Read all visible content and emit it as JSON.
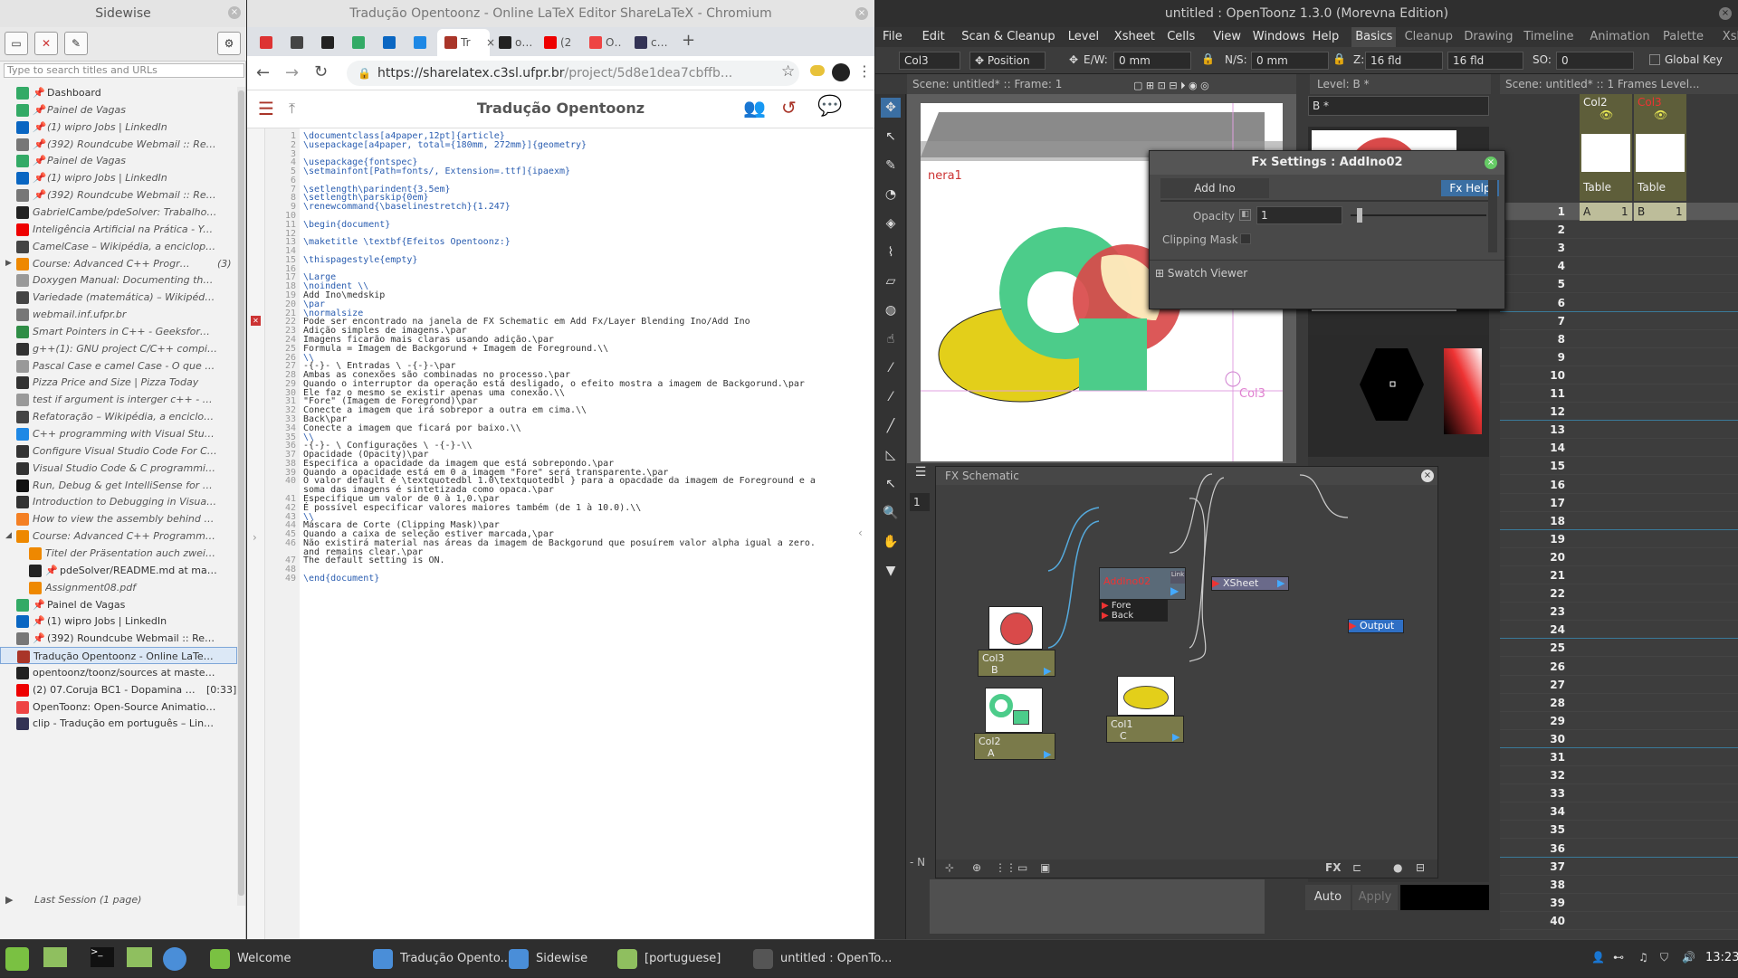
{
  "sidewise": {
    "title": "Sidewise",
    "search_placeholder": "Type to search titles and URLs",
    "items": [
      {
        "label": "Dashboard",
        "pinned": true,
        "icon": "trello-icon",
        "color": "#3a6"
      },
      {
        "label": "Painel de Vagas",
        "pinned": true,
        "icon": "trello-icon",
        "color": "#3a6",
        "italic": true
      },
      {
        "label": "(1) wipro Jobs | LinkedIn",
        "pinned": true,
        "icon": "linkedin-icon",
        "color": "#0a66c2",
        "italic": true
      },
      {
        "label": "(392) Roundcube Webmail :: Resulta...",
        "pinned": true,
        "icon": "roundcube-icon",
        "color": "#777",
        "italic": true
      },
      {
        "label": "Painel de Vagas",
        "pinned": true,
        "icon": "trello-icon",
        "color": "#3a6",
        "italic": true
      },
      {
        "label": "(1) wipro Jobs | LinkedIn",
        "pinned": true,
        "icon": "linkedin-icon",
        "color": "#0a66c2",
        "italic": true
      },
      {
        "label": "(392) Roundcube Webmail :: Resulta...",
        "pinned": true,
        "icon": "roundcube-icon",
        "color": "#777",
        "italic": true
      },
      {
        "label": "GabrielCambe/pdeSolver: Trabalho 1 da d...",
        "icon": "github-icon",
        "color": "#222",
        "italic": true
      },
      {
        "label": "Inteligência Artificial na Prática - YouTube",
        "icon": "youtube-icon",
        "color": "#e00",
        "italic": true
      },
      {
        "label": "CamelCase – Wikipédia, a enciclopédia livre",
        "icon": "wikipedia-icon",
        "color": "#444",
        "italic": true
      },
      {
        "label": "Course: Advanced C++ Programming",
        "icon": "moodle-icon",
        "color": "#e80",
        "italic": true,
        "count": "(3)",
        "expander": "▶"
      },
      {
        "label": "Doxygen Manual: Documenting the code",
        "icon": "doxygen-icon",
        "color": "#999",
        "italic": true
      },
      {
        "label": "Variedade (matemática) – Wikipédia, a en...",
        "icon": "wikipedia-icon",
        "color": "#444",
        "italic": true
      },
      {
        "label": "webmail.inf.ufpr.br",
        "icon": "roundcube-icon",
        "color": "#777",
        "italic": true
      },
      {
        "label": "Smart Pointers in C++ - GeeksforGeeks",
        "icon": "gfg-icon",
        "color": "#2f8d46",
        "italic": true
      },
      {
        "label": "g++(1): GNU project C/C++ compiler - Lin...",
        "icon": "terminal-icon",
        "color": "#333",
        "italic": true
      },
      {
        "label": "Pascal Case e camel Case - O que é e co...",
        "icon": "page-icon",
        "color": "#999",
        "italic": true
      },
      {
        "label": "Pizza Price and Size | Pizza Today",
        "icon": "pizza-icon",
        "color": "#333",
        "italic": true
      },
      {
        "label": "test if argument is interger c++ - Pesquisa ...",
        "icon": "google-icon",
        "color": "#999",
        "italic": true
      },
      {
        "label": "Refatoração – Wikipédia, a enciclopédia li...",
        "icon": "wikipedia-icon",
        "color": "#444",
        "italic": true
      },
      {
        "label": "C++ programming with Visual Studio Code",
        "icon": "vscode-icon",
        "color": "#1e88e5",
        "italic": true
      },
      {
        "label": "Configure Visual Studio Code For C++ De...",
        "icon": "vscode-icon",
        "color": "#333",
        "italic": true
      },
      {
        "label": "Visual Studio Code & C programming on ...",
        "icon": "vscode-icon",
        "color": "#333",
        "italic": true
      },
      {
        "label": "Run, Debug & get IntelliSense for C C++ i...",
        "icon": "medium-icon",
        "color": "#111",
        "italic": true
      },
      {
        "label": "Introduction to Debugging in Visual Studio...",
        "icon": "vscode-icon",
        "color": "#333",
        "italic": true
      },
      {
        "label": "How to view the assembly behind the cod...",
        "icon": "stackoverflow-icon",
        "color": "#f48024",
        "italic": true
      },
      {
        "label": "Course: Advanced C++ Programming",
        "icon": "moodle-icon",
        "color": "#e80",
        "italic": true,
        "expander": "◢"
      },
      {
        "label": "Titel der Präsentation auch zweizeilig U...",
        "icon": "moodle-icon",
        "color": "#e80",
        "italic": true,
        "indent": 1
      },
      {
        "label": "pdeSolver/README.md at master · ...",
        "pinned": true,
        "icon": "github-icon",
        "color": "#222",
        "indent": 1
      },
      {
        "label": "Assignment08.pdf",
        "icon": "moodle-icon",
        "color": "#e80",
        "italic": true,
        "indent": 1
      },
      {
        "label": "Painel de Vagas",
        "pinned": true,
        "icon": "trello-icon",
        "color": "#3a6"
      },
      {
        "label": "(1) wipro Jobs | LinkedIn",
        "pinned": true,
        "icon": "linkedin-icon",
        "color": "#0a66c2"
      },
      {
        "label": "(392) Roundcube Webmail :: Resulta...",
        "pinned": true,
        "icon": "roundcube-icon",
        "color": "#777"
      },
      {
        "label": "Tradução Opentoonz - Online LaTeX Edito...",
        "icon": "sharelatex-icon",
        "color": "#a93529",
        "selected": true
      },
      {
        "label": "opentoonz/toonz/sources at master · open...",
        "icon": "github-icon",
        "color": "#222"
      },
      {
        "label": "(2) 07.Coruja BC1 - Dopamina - Yo...",
        "icon": "youtube-icon",
        "color": "#e00",
        "badge": "[0:33]"
      },
      {
        "label": "OpenToonz: Open-Source Animation Prod...",
        "icon": "opentoonz-icon",
        "color": "#e44"
      },
      {
        "label": "clip - Tradução em português – Linguee",
        "icon": "linguee-icon",
        "color": "#335"
      }
    ],
    "last_session": "Last Session (1 page)"
  },
  "chromium": {
    "title": "Tradução Opentoonz - Online LaTeX Editor ShareLaTeX - Chromium",
    "tabs": [
      {
        "label": "",
        "icon": "gmail-icon",
        "color": "#d33"
      },
      {
        "label": "",
        "icon": "headphones-icon",
        "color": "#444"
      },
      {
        "label": "",
        "icon": "github-icon",
        "color": "#222"
      },
      {
        "label": "",
        "icon": "trello-icon",
        "color": "#3a6"
      },
      {
        "label": "",
        "icon": "linkedin-icon",
        "color": "#0a66c2"
      },
      {
        "label": "",
        "icon": "bookmark-icon",
        "color": "#1e88e5"
      },
      {
        "label": "Tr",
        "icon": "sharelatex-icon",
        "color": "#a93529",
        "active": true
      },
      {
        "label": "openi",
        "icon": "github-icon",
        "color": "#222"
      },
      {
        "label": "(2",
        "icon": "youtube-icon",
        "color": "#e00"
      },
      {
        "label": "Open",
        "icon": "opentoonz-icon",
        "color": "#e44"
      },
      {
        "label": "clip ·",
        "icon": "linguee-icon",
        "color": "#335"
      }
    ],
    "url_host": "https://sharelatex.c3sl.ufpr.br",
    "url_path": "/project/5d8e1dea7cbffb...",
    "project_title": "Tradução Opentoonz",
    "code_lines": [
      "\\documentclass[a4paper,12pt]{article}",
      "\\usepackage[a4paper, total={180mm, 272mm}]{geometry}",
      "",
      "\\usepackage{fontspec}",
      "\\setmainfont[Path=fonts/, Extension=.ttf]{ipaexm}",
      "",
      "\\setlength\\parindent{3.5em}",
      "\\setlength\\parskip{0em}",
      "\\renewcommand{\\baselinestretch}{1.247}",
      "",
      "\\begin{document}",
      "",
      "\\maketitle \\textbf{Efeitos Opentoonz:}",
      "",
      "\\thispagestyle{empty}",
      "",
      "\\Large",
      "\\noindent \\\\",
      "Add Ino\\medskip",
      "\\par",
      "\\normalsize",
      "Pode ser encontrado na janela de FX Schematic em Add Fx/Layer Blending Ino/Add Ino",
      "Adição simples de imagens.\\par",
      "Imagens ficarão mais claras usando adição.\\par",
      "Formula = Imagem de Backgorund + Imagem de Foreground.\\\\",
      "\\\\",
      "-{-}- \\ Entradas \\ -{-}-\\par",
      "Ambas as conexões são combinadas no processo.\\par",
      "Quando o interruptor da operação está desligado, o efeito mostra a imagem de Backgorund.\\par",
      "Ele faz o mesmo se existir apenas uma conexão.\\\\",
      "\"Fore\" (Imagem de Foregrond)\\par",
      "Conecte a imagem que irá sobrepor a outra em cima.\\\\",
      "Back\\par",
      "Conecte a imagem que ficará por baixo.\\\\",
      "\\\\",
      "-{-}- \\ Configurações \\ -{-}-\\\\",
      "Opacidade (Opacity)\\par",
      "Especifica a opacidade da imagem que está sobrepondo.\\par",
      "Quando a opacidade está em 0 a imagem \"Fore\" será transparente.\\par",
      "O valor default é \\textquotedbl 1.0\\textquotedbl } para a opacdade da imagem de Foreground e a",
      "soma das imagens é sintetizada como opaca.\\par",
      "Especifique um valor de 0 à 1,0.\\par",
      "É possível especificar valores maiores também (de 1 à 10.0).\\\\",
      "\\\\",
      "Máscara de Corte (Clipping Mask)\\par",
      "Quando a caixa de seleção estiver marcada,\\par",
      "Não existirá material nas áreas da imagem de Backgorund que posuírem valor alpha igual a zero.",
      "and remains clear.\\par",
      "The default setting is ON.",
      "",
      "\\end{document}"
    ],
    "line_numbers": [
      "1",
      "2",
      "3",
      "4",
      "5",
      "6",
      "7",
      "8",
      "9",
      "10",
      "11",
      "12",
      "13",
      "14",
      "15",
      "16",
      "17",
      "18",
      "19",
      "20",
      "21",
      "22",
      "23",
      "24",
      "25",
      "26",
      "27",
      "28",
      "29",
      "30",
      "31",
      "32",
      "33",
      "34",
      "35",
      "36",
      "37",
      "38",
      "39",
      "40",
      "",
      "41",
      "42",
      "43",
      "44",
      "45",
      "46",
      "",
      "47",
      "48",
      "49"
    ]
  },
  "opentoonz": {
    "title": "untitled : OpenToonz 1.3.0 (Morevna Edition)",
    "menu": [
      "File",
      "Edit",
      "Scan & Cleanup",
      "Level",
      "Xsheet",
      "Cells",
      "View",
      "Windows",
      "Help",
      "Basics",
      "Cleanup",
      "Drawing",
      "Timeline",
      "Animation",
      "Palette",
      "Xsheet"
    ],
    "toolopt": {
      "column": "Col3",
      "mode": "Position",
      "ew_label": "E/W:",
      "ew": "0 mm",
      "ns_label": "N/S:",
      "ns": "0 mm",
      "z_label": "Z:",
      "z": "16 fld",
      "z2": "16 fld",
      "so_label": "SO:",
      "so": "0",
      "global_key": "Global Key"
    },
    "viewer_head": "Scene: untitled*   ::   Frame: 1",
    "level_head": "Level:  B *",
    "level_name": "B *",
    "xsheet_head": "Scene: untitled*   ::   1 Frames  Level...",
    "columns": [
      {
        "name": "Col2",
        "cell": "A"
      },
      {
        "name": "Col3",
        "cell": "B"
      }
    ],
    "column_type": "Table",
    "rows": [
      "1",
      "2",
      "3",
      "4",
      "5",
      "6",
      "7",
      "8",
      "9",
      "10",
      "11",
      "12",
      "13",
      "14",
      "15",
      "16",
      "17",
      "18",
      "19",
      "20",
      "21",
      "22",
      "23",
      "24",
      "25",
      "26",
      "27",
      "28",
      "29",
      "30",
      "31",
      "32",
      "33",
      "34",
      "35",
      "36",
      "37",
      "38",
      "39",
      "40"
    ],
    "cell_a_frame": "1",
    "cell_b_frame": "1",
    "camera_label": "nera1",
    "col3_label": "Col3",
    "fxsettings": {
      "title": "Fx Settings : AddIno02",
      "tab": "Add Ino",
      "help": "Fx Help",
      "opacity_label": "Opacity",
      "opacity_value": "1",
      "clip_label": "Clipping Mask",
      "swatch": "Swatch Viewer"
    },
    "fxschematic": {
      "title": "FX Schematic",
      "addnode": "AddIno02",
      "link": "Link",
      "fore": "Fore",
      "back": "Back",
      "xsheet": "XSheet",
      "output": "Output",
      "col3": {
        "name": "Col3",
        "level": "B"
      },
      "col2": {
        "name": "Col2",
        "level": "A"
      },
      "col1": {
        "name": "Col1",
        "level": "C"
      },
      "footer_fx": "FX"
    },
    "xsheet_frame_field": "1",
    "side_label": "- N",
    "apply_auto": "Auto",
    "apply": "Apply"
  },
  "taskbar": {
    "items": [
      {
        "label": "Welcome",
        "icon": "mint-icon"
      },
      {
        "label": "Tradução Opento...",
        "icon": "chromium-icon"
      },
      {
        "label": "Sidewise",
        "icon": "chromium-icon"
      },
      {
        "label": "[portuguese]",
        "icon": "folder-icon"
      },
      {
        "label": "untitled : OpenTo...",
        "icon": "window-icon"
      }
    ],
    "clock": "13:23"
  }
}
